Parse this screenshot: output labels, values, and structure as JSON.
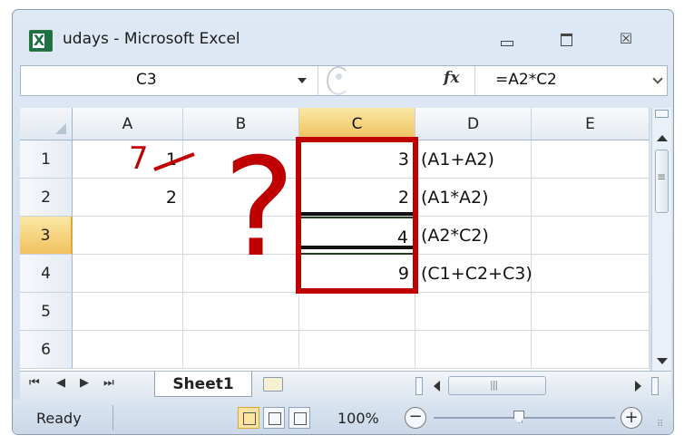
{
  "window": {
    "title": "udays - Microsoft Excel",
    "app_icon_letter": "X",
    "close_glyph": "☒"
  },
  "formula_bar": {
    "name_box": "C3",
    "fx_label": "fx",
    "formula": "=A2*C2"
  },
  "columns": [
    "A",
    "B",
    "C",
    "D",
    "E"
  ],
  "rows": [
    "1",
    "2",
    "3",
    "4",
    "5",
    "6"
  ],
  "cells": {
    "A1": "1",
    "A2": "2",
    "C1": "3",
    "C2": "2",
    "C3": "4",
    "C4": "9",
    "D1": "(A1+A2)",
    "D2": "(A1*A2)",
    "D3": "(A2*C2)",
    "D4": "(C1+C2+C3)"
  },
  "selected_cell": "C3",
  "sheet_tabs": {
    "nav": [
      "⏮",
      "◀",
      "▶",
      "⏭"
    ],
    "active_tab": "Sheet1"
  },
  "status_bar": {
    "status": "Ready",
    "zoom": "100%",
    "zoom_minus": "−",
    "zoom_plus": "+"
  },
  "annotations": {
    "handwritten_number": "7",
    "question_mark": "?",
    "color": "#c00000"
  }
}
